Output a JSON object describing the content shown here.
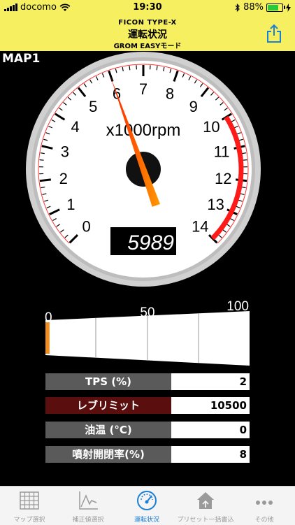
{
  "status_bar": {
    "carrier": "docomo",
    "time": "19:30",
    "battery": "88%",
    "battery_level": 0.88
  },
  "nav": {
    "line1": "FICON TYPE-X",
    "title": "運転状況",
    "subtitle": "GROM EASYモード"
  },
  "map_label": "MAP1",
  "tachometer": {
    "unit_label": "x1000rpm",
    "tick_labels": [
      "0",
      "1",
      "2",
      "3",
      "4",
      "5",
      "6",
      "7",
      "8",
      "9",
      "10",
      "11",
      "12",
      "13",
      "14"
    ],
    "rpm": 5989,
    "readout": "5989",
    "max_thousands": 14,
    "redline_from_thousands": 10
  },
  "bar_gauge": {
    "labels": [
      "0",
      "50",
      "100"
    ],
    "value_percent": 2
  },
  "readings": [
    {
      "label": "TPS (%)",
      "value": "2",
      "label_bg": "#5a5a5a"
    },
    {
      "label": "レブリミット",
      "value": "10500",
      "label_bg": "#5a0e0e"
    },
    {
      "label": "油温 (°C)",
      "value": "0",
      "label_bg": "#5a5a5a"
    },
    {
      "label": "噴射開閉率(%)",
      "value": "8",
      "label_bg": "#5a5a5a"
    }
  ],
  "tabs": [
    {
      "label": "マップ選択",
      "icon": "grid-icon"
    },
    {
      "label": "補正値選択",
      "icon": "line-chart-icon"
    },
    {
      "label": "運転状況",
      "icon": "gauge-icon",
      "active": true
    },
    {
      "label": "プリセット一括書込",
      "icon": "house-upload-icon"
    },
    {
      "label": "その他",
      "icon": "more-icon"
    }
  ],
  "colors": {
    "accent_yellow": "#f6ef5f",
    "needle_red": "#ff2200",
    "needle_orange": "#ff8800",
    "tab_active": "#1b7fd6"
  }
}
